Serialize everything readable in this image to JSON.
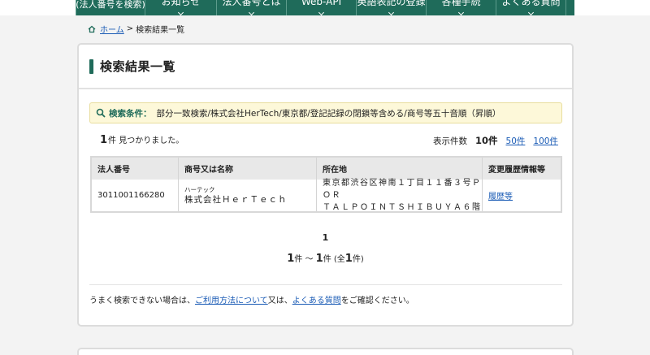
{
  "nav": {
    "items": [
      {
        "label": "(法人番号を検索)",
        "small": true,
        "chevron": false,
        "width": 86
      },
      {
        "label": "お知らせ",
        "chevron": true,
        "width": 88
      },
      {
        "label": "法人番号とは",
        "chevron": true,
        "width": 86
      },
      {
        "label": "Web-API",
        "chevron": true,
        "width": 86
      },
      {
        "label": "英語表記の登録",
        "chevron": true,
        "width": 86
      },
      {
        "label": "各種手続",
        "chevron": true,
        "width": 86
      },
      {
        "label": "よくある質問",
        "chevron": true,
        "width": 86
      }
    ]
  },
  "breadcrumb": {
    "home": "ホーム",
    "separator": ">",
    "current": "検索結果一覧"
  },
  "page_title": "検索結果一覧",
  "search_condition": {
    "label": "検索条件：",
    "value": "部分一致検索/株式会社HerTech/東京都/登記記録の閉鎖等含める/商号等五十音順（昇順）"
  },
  "results": {
    "count": "1",
    "found_suffix": "件 見つかりました。"
  },
  "page_size": {
    "label": "表示件数",
    "current": "10件",
    "options": [
      "50件",
      "100件"
    ]
  },
  "table": {
    "headers": [
      "法人番号",
      "商号又は名称",
      "所在地",
      "変更履歴情報等"
    ],
    "rows": [
      {
        "number": "3011001166280",
        "kana": "ハーテック",
        "name": "株式会社ＨｅｒＴｅｃｈ",
        "address_line1": "東京都渋谷区神南１丁目１１番３号ＰＯＲ",
        "address_line2": "ＴＡＬＰＯＩＮＴＳＨＩＢＵＹＡ６階",
        "history_link": "履歴等"
      }
    ]
  },
  "pager": {
    "current_page": "1",
    "range_start": "1",
    "range_sep": "件 〜 ",
    "range_end": "1",
    "range_mid": "件 (全",
    "total": "1",
    "range_suffix": "件)"
  },
  "help": {
    "prefix": "うまく検索できない場合は、",
    "link1": "ご利用方法について",
    "mid": "又は、",
    "link2": "よくある質問",
    "suffix": "をご確認ください。"
  },
  "colors": {
    "brand": "#1f6b5a",
    "link": "#1a5bb5",
    "condition_bg": "#fdf8d9"
  }
}
